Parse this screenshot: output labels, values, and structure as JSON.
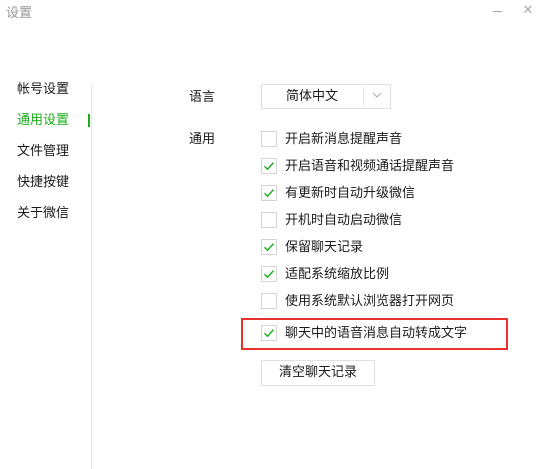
{
  "window": {
    "title": "设置",
    "minimize_glyph": "",
    "close_glyph": "✕"
  },
  "sidebar": {
    "items": [
      {
        "label": "帐号设置",
        "active": false
      },
      {
        "label": "通用设置",
        "active": true
      },
      {
        "label": "文件管理",
        "active": false
      },
      {
        "label": "快捷按键",
        "active": false
      },
      {
        "label": "关于微信",
        "active": false
      }
    ]
  },
  "language": {
    "label": "语言",
    "selected": "简体中文",
    "dropdown_icon": "chevron-down-icon"
  },
  "general": {
    "label": "通用",
    "options": [
      {
        "label": "开启新消息提醒声音",
        "checked": false
      },
      {
        "label": "开启语音和视频通话提醒声音",
        "checked": true
      },
      {
        "label": "有更新时自动升级微信",
        "checked": true
      },
      {
        "label": "开机时自动启动微信",
        "checked": false
      },
      {
        "label": "保留聊天记录",
        "checked": true
      },
      {
        "label": "适配系统缩放比例",
        "checked": true
      },
      {
        "label": "使用系统默认浏览器打开网页",
        "checked": false
      },
      {
        "label": "聊天中的语音消息自动转成文字",
        "checked": true,
        "highlighted": true
      }
    ],
    "clear_button": "清空聊天记录"
  },
  "colors": {
    "accent": "#1aad19",
    "checkmark": "#1aad19",
    "highlight": "#e8302d",
    "title_text": "#999999",
    "border": "#e1e1e1"
  }
}
